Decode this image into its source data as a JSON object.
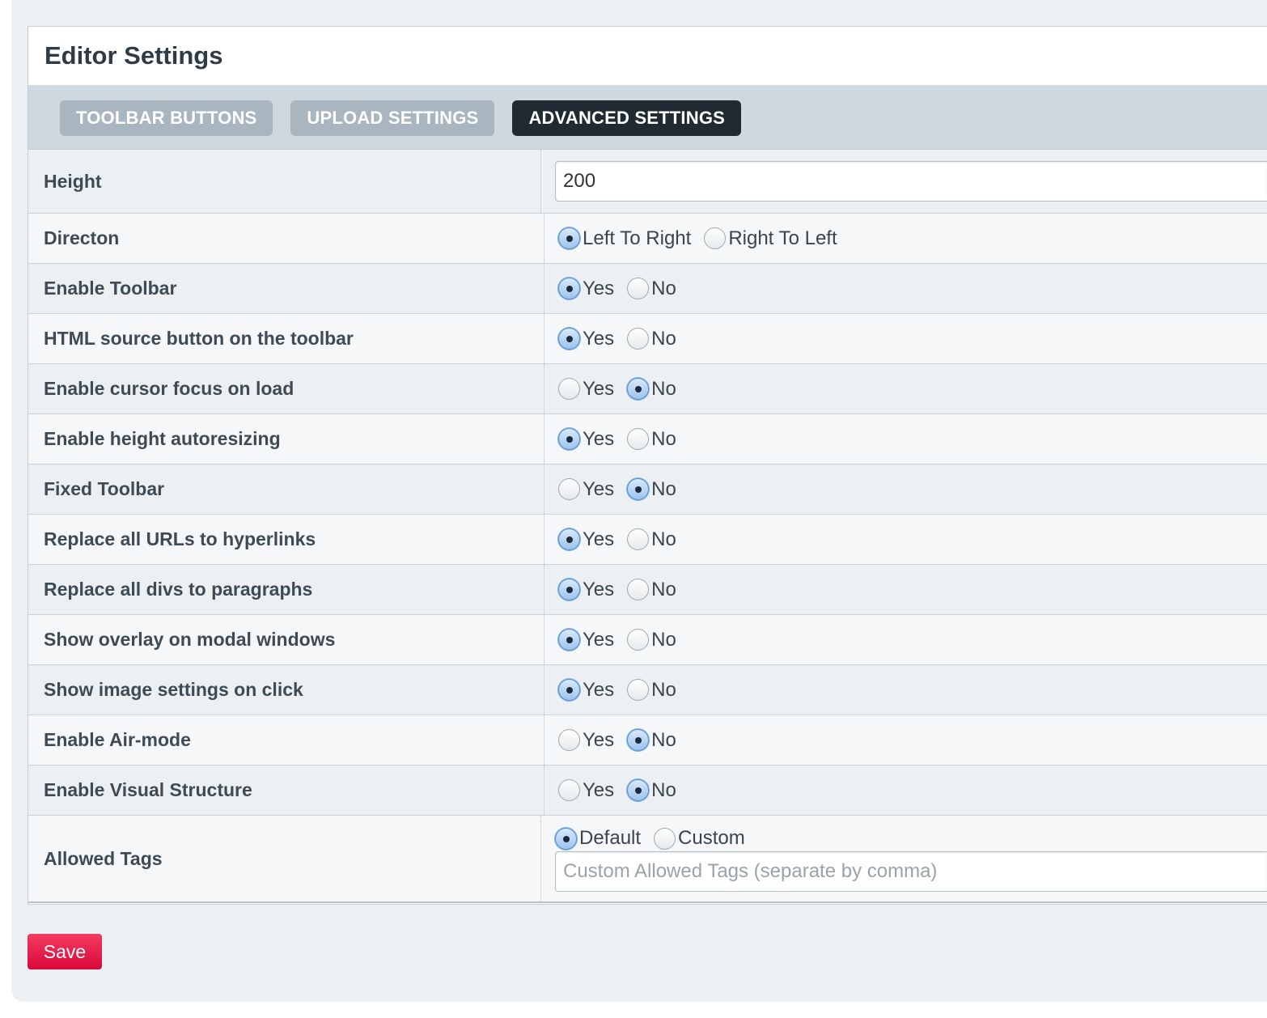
{
  "panel": {
    "title": "Editor Settings"
  },
  "tabs": [
    {
      "label": "TOOLBAR BUTTONS",
      "active": false
    },
    {
      "label": "UPLOAD SETTINGS",
      "active": false
    },
    {
      "label": "ADVANCED SETTINGS",
      "active": true
    }
  ],
  "height": {
    "label": "Height",
    "value": "200"
  },
  "direction": {
    "label": "Directon",
    "options": [
      "Left To Right",
      "Right To Left"
    ],
    "selected": "Left To Right"
  },
  "settings": [
    {
      "label": "Enable Toolbar",
      "selected": "Yes"
    },
    {
      "label": "HTML source button on the toolbar",
      "selected": "Yes"
    },
    {
      "label": "Enable cursor focus on load",
      "selected": "No"
    },
    {
      "label": "Enable height autoresizing",
      "selected": "Yes"
    },
    {
      "label": "Fixed Toolbar",
      "selected": "No"
    },
    {
      "label": "Replace all URLs to hyperlinks",
      "selected": "Yes"
    },
    {
      "label": "Replace all divs to paragraphs",
      "selected": "Yes"
    },
    {
      "label": "Show overlay on modal windows",
      "selected": "Yes"
    },
    {
      "label": "Show image settings on click",
      "selected": "Yes"
    },
    {
      "label": "Enable Air-mode",
      "selected": "No"
    },
    {
      "label": "Enable Visual Structure",
      "selected": "No"
    }
  ],
  "yes_no": {
    "yes": "Yes",
    "no": "No"
  },
  "allowed_tags": {
    "label": "Allowed Tags",
    "options": [
      "Default",
      "Custom"
    ],
    "selected": "Default",
    "placeholder": "Custom Allowed Tags (separate by comma)"
  },
  "save_label": "Save",
  "colors": {
    "accent": "#e5154a",
    "active_tab": "#1f2a33",
    "radio_checked": "#9cc4ee"
  }
}
